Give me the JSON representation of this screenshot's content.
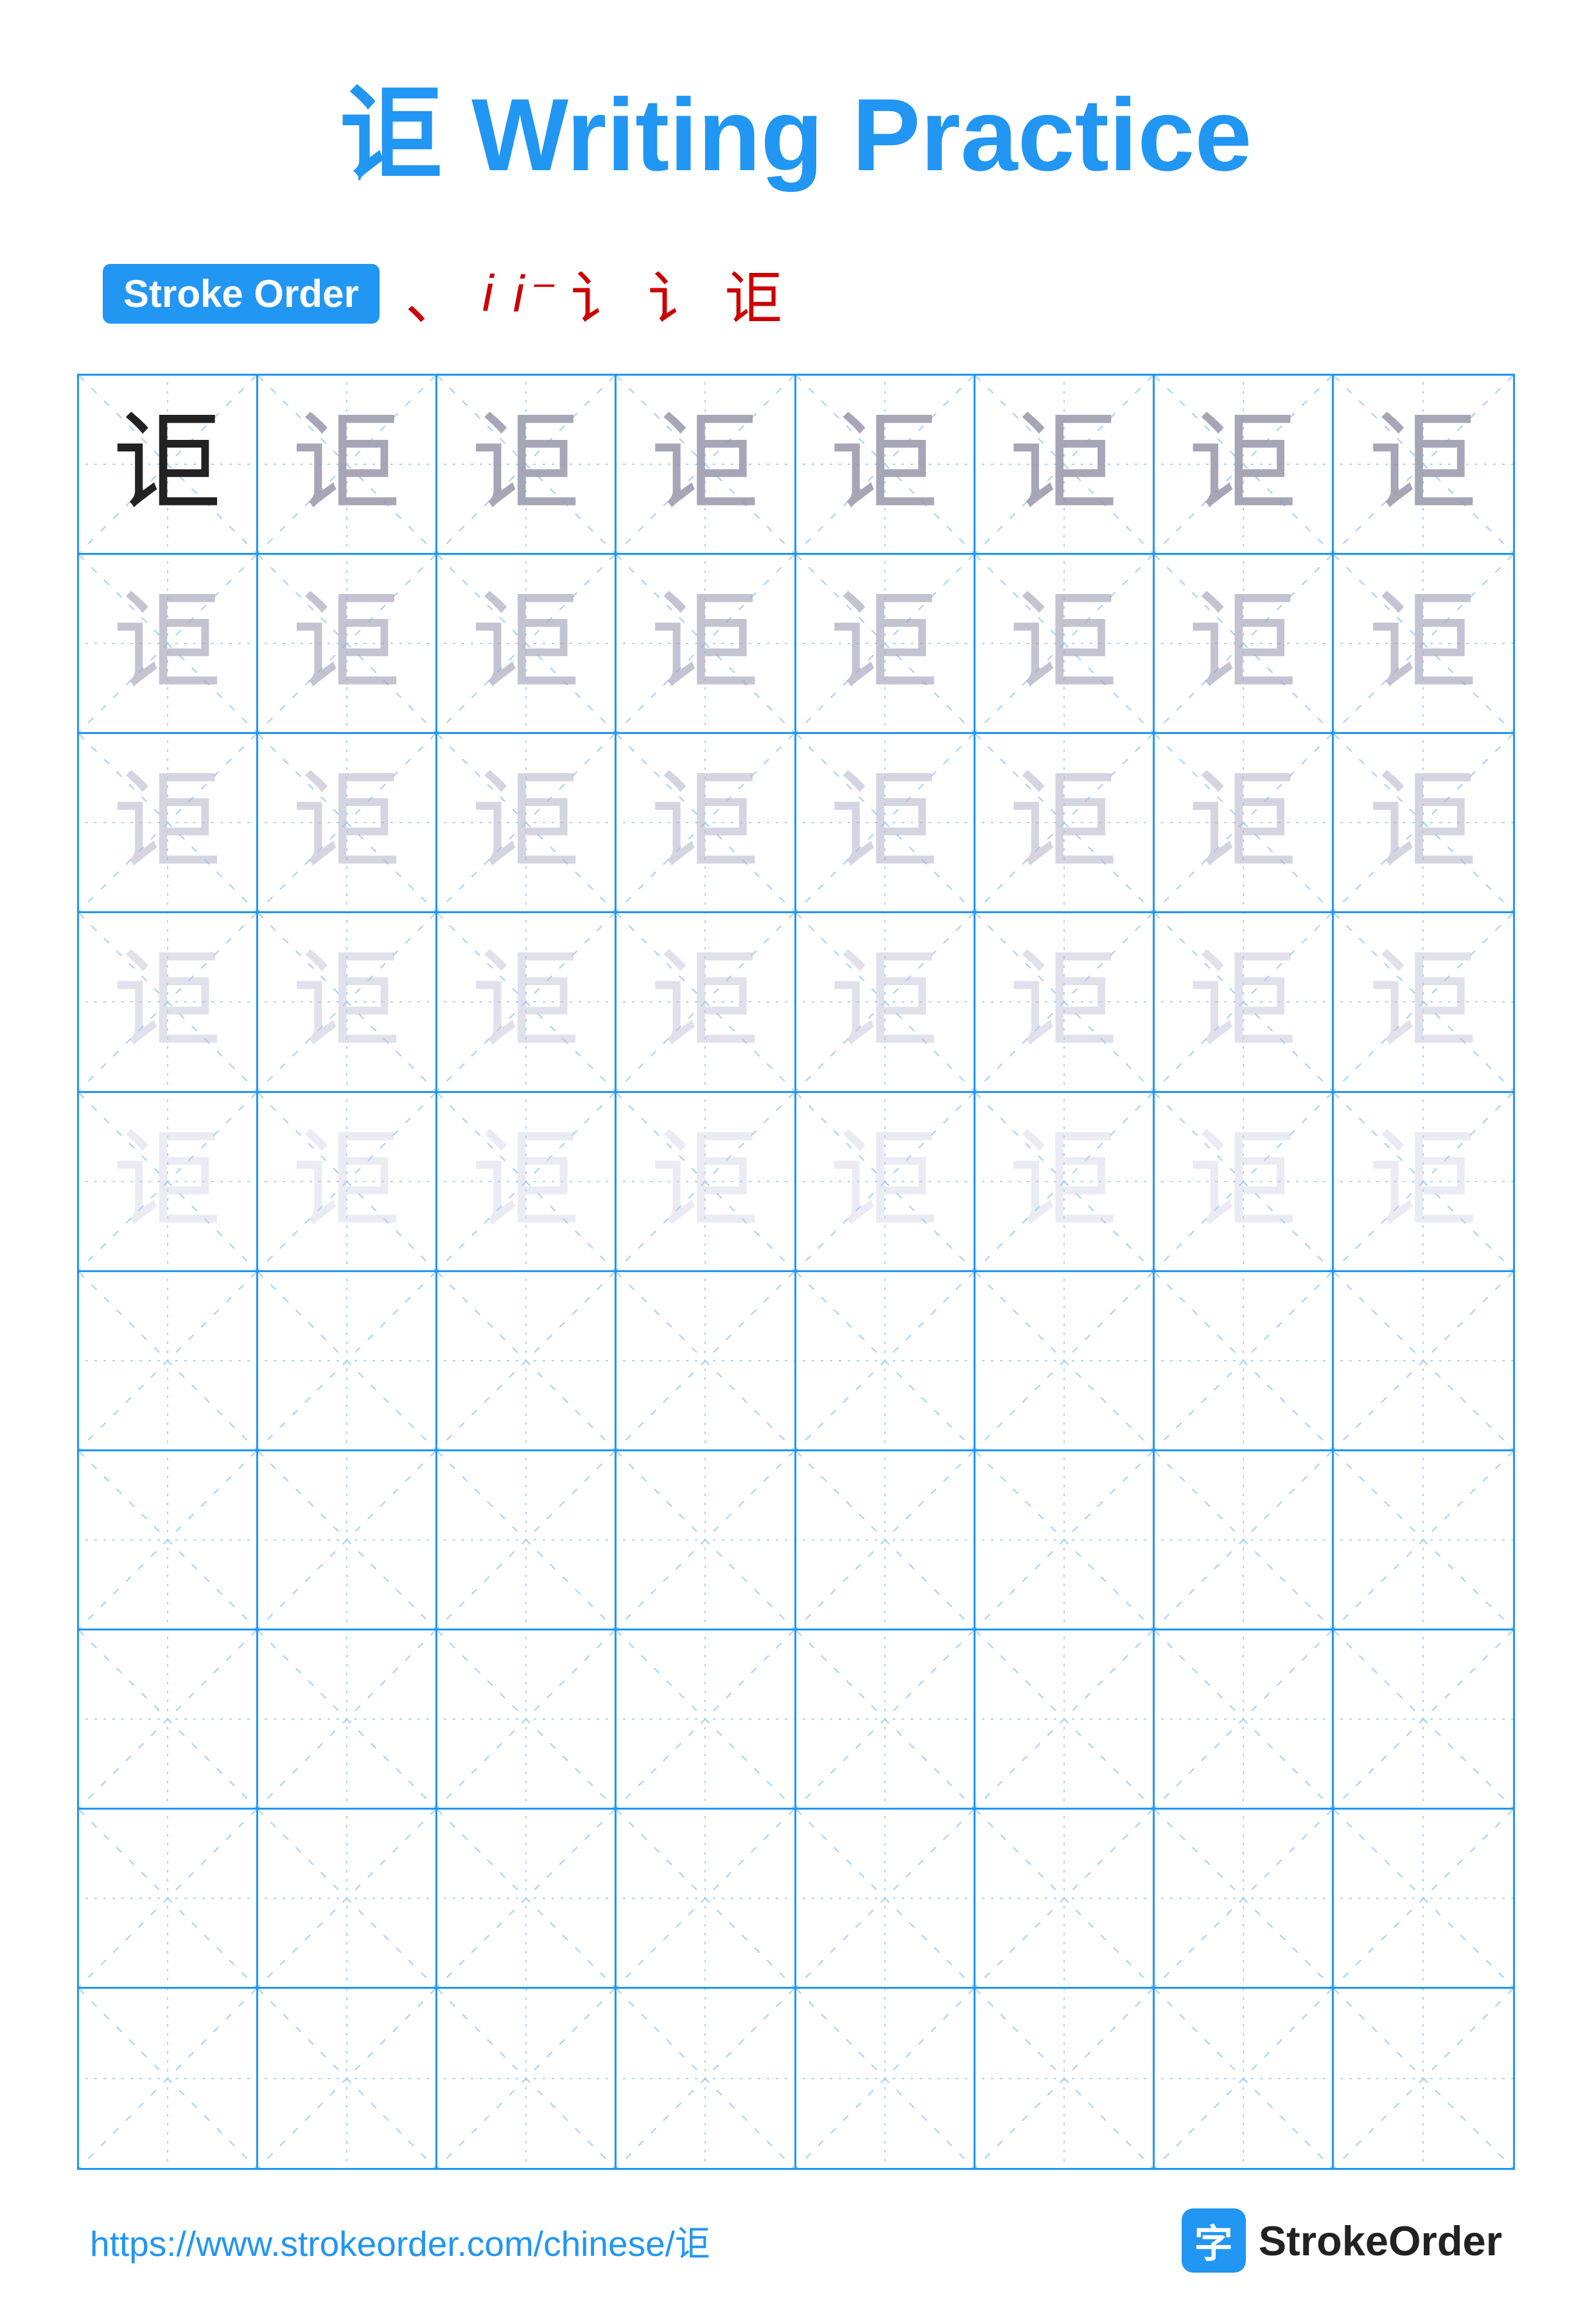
{
  "title": {
    "char": "讵",
    "suffix": " Writing Practice"
  },
  "stroke_order": {
    "badge_label": "Stroke Order",
    "strokes": [
      "⁴",
      "㇀",
      "亅",
      "讠",
      "讠",
      "讵"
    ]
  },
  "grid": {
    "character": "讵",
    "rows": 10,
    "cols": 8,
    "filled_rows": 5,
    "empty_rows": 5
  },
  "footer": {
    "url": "https://www.strokeorder.com/chinese/讵",
    "logo_icon": "字",
    "logo_text": "StrokeOrder"
  }
}
